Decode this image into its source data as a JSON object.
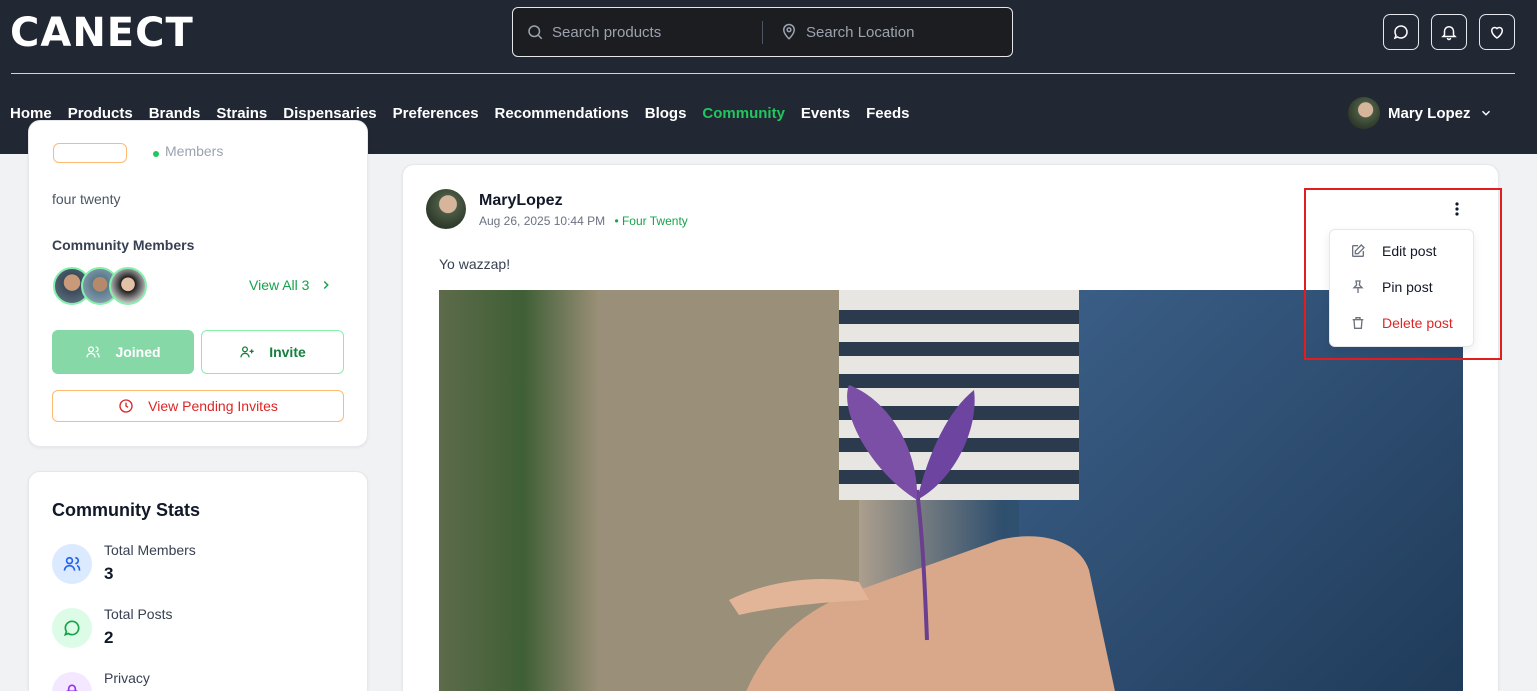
{
  "header": {
    "logo": "CANECT",
    "search_products_placeholder": "Search products",
    "search_location_placeholder": "Search Location",
    "icons": [
      "chat-icon",
      "bell-icon",
      "heart-icon"
    ]
  },
  "nav": {
    "items": [
      "Home",
      "Products",
      "Brands",
      "Strains",
      "Dispensaries",
      "Preferences",
      "Recommendations",
      "Blogs",
      "Community",
      "Events",
      "Feeds"
    ],
    "active": "Community"
  },
  "user": {
    "name": "Mary Lopez"
  },
  "community_card": {
    "members_label": "Members",
    "description": "four twenty",
    "members_title": "Community Members",
    "view_all": "View All 3",
    "joined_label": "Joined",
    "invite_label": "Invite",
    "pending_label": "View Pending Invites"
  },
  "stats": {
    "title": "Community Stats",
    "items": [
      {
        "label": "Total Members",
        "value": "3",
        "icon": "users-icon",
        "color": "#dbeafe"
      },
      {
        "label": "Total Posts",
        "value": "2",
        "icon": "message-icon",
        "color": "#dcfce7"
      },
      {
        "label": "Privacy",
        "value": "",
        "icon": "lock-icon",
        "color": "#f3e8ff"
      }
    ]
  },
  "post": {
    "author": "MaryLopez",
    "timestamp": "Aug 26, 2025 10:44 PM",
    "community": "• Four Twenty",
    "text": "Yo wazzap!"
  },
  "post_menu": {
    "items": [
      {
        "label": "Edit post",
        "icon": "edit-icon"
      },
      {
        "label": "Pin post",
        "icon": "pin-icon"
      },
      {
        "label": "Delete post",
        "icon": "trash-icon"
      }
    ]
  },
  "colors": {
    "header_bg": "#222734",
    "accent_green": "#22c55e",
    "danger": "#dc2626",
    "highlight_box": "#e11d1d"
  }
}
